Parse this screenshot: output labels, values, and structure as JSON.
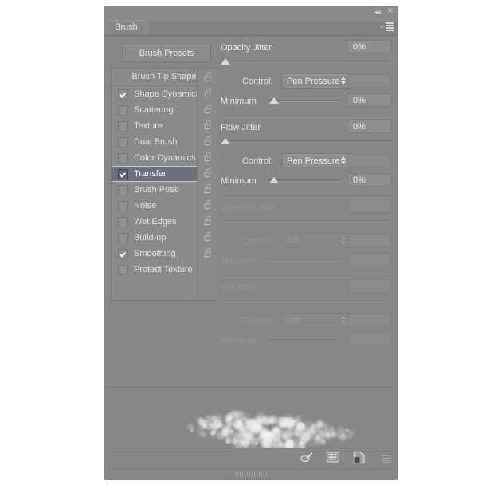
{
  "window": {
    "collapse_icon": "double-chevron-left",
    "close_icon": "close-x",
    "collapse_glyph": "◂◂",
    "close_glyph": "✕"
  },
  "tab": {
    "label": "Brush",
    "menu_icon": "panel-menu-icon"
  },
  "left": {
    "presets_button": "Brush Presets",
    "header": "Brush Tip Shape",
    "options": [
      {
        "label": "Shape Dynamics",
        "checked": true,
        "selected": false
      },
      {
        "label": "Scattering",
        "checked": false,
        "selected": false
      },
      {
        "label": "Texture",
        "checked": false,
        "selected": false
      },
      {
        "label": "Dual Brush",
        "checked": false,
        "selected": false
      },
      {
        "label": "Color Dynamics",
        "checked": false,
        "selected": false
      },
      {
        "label": "Transfer",
        "checked": true,
        "selected": true
      },
      {
        "label": "Brush Pose",
        "checked": false,
        "selected": false
      },
      {
        "label": "Noise",
        "checked": false,
        "selected": false
      },
      {
        "label": "Wet Edges",
        "checked": false,
        "selected": false
      },
      {
        "label": "Build-up",
        "checked": false,
        "selected": false
      },
      {
        "label": "Smoothing",
        "checked": true,
        "selected": false
      },
      {
        "label": "Protect Texture",
        "checked": false,
        "selected": false
      }
    ],
    "lock_icon": "lock-open-icon"
  },
  "right": {
    "groups": [
      {
        "title": "Opacity Jitter",
        "value": "0%",
        "slider_pct": 0,
        "enabled": true,
        "control_label": "Control:",
        "control_value": "Pen Pressure",
        "minimum_label": "Minimum",
        "minimum_value": "0%",
        "minimum_pct": 4
      },
      {
        "title": "Flow Jitter",
        "value": "0%",
        "slider_pct": 0,
        "enabled": true,
        "control_label": "Control:",
        "control_value": "Pen Pressure",
        "minimum_label": "Minimum",
        "minimum_value": "0%",
        "minimum_pct": 4
      },
      {
        "title": "Wetness Jitter",
        "value": "",
        "slider_pct": 0,
        "enabled": false,
        "control_label": "Control:",
        "control_value": "Off",
        "minimum_label": "Minimum",
        "minimum_value": "",
        "minimum_pct": 0
      },
      {
        "title": "Mix Jitter",
        "value": "",
        "slider_pct": 0,
        "enabled": false,
        "control_label": "Control:",
        "control_value": "Off",
        "minimum_label": "Minimum",
        "minimum_value": "",
        "minimum_pct": 0
      }
    ]
  },
  "footer": {
    "icons": [
      {
        "name": "tablet-pressure-opacity-icon"
      },
      {
        "name": "brush-preset-picker-icon"
      },
      {
        "name": "new-brush-icon"
      }
    ],
    "resize_grip": "resize-grip-icon",
    "drag_handle": "panel-drag-handle"
  },
  "preview": {
    "alt": "brush-stroke-preview"
  },
  "colors": {
    "panel_bg": "#878787",
    "selection": "#6b7080",
    "text": "#e6e6e6",
    "text_disabled": "#949494"
  }
}
